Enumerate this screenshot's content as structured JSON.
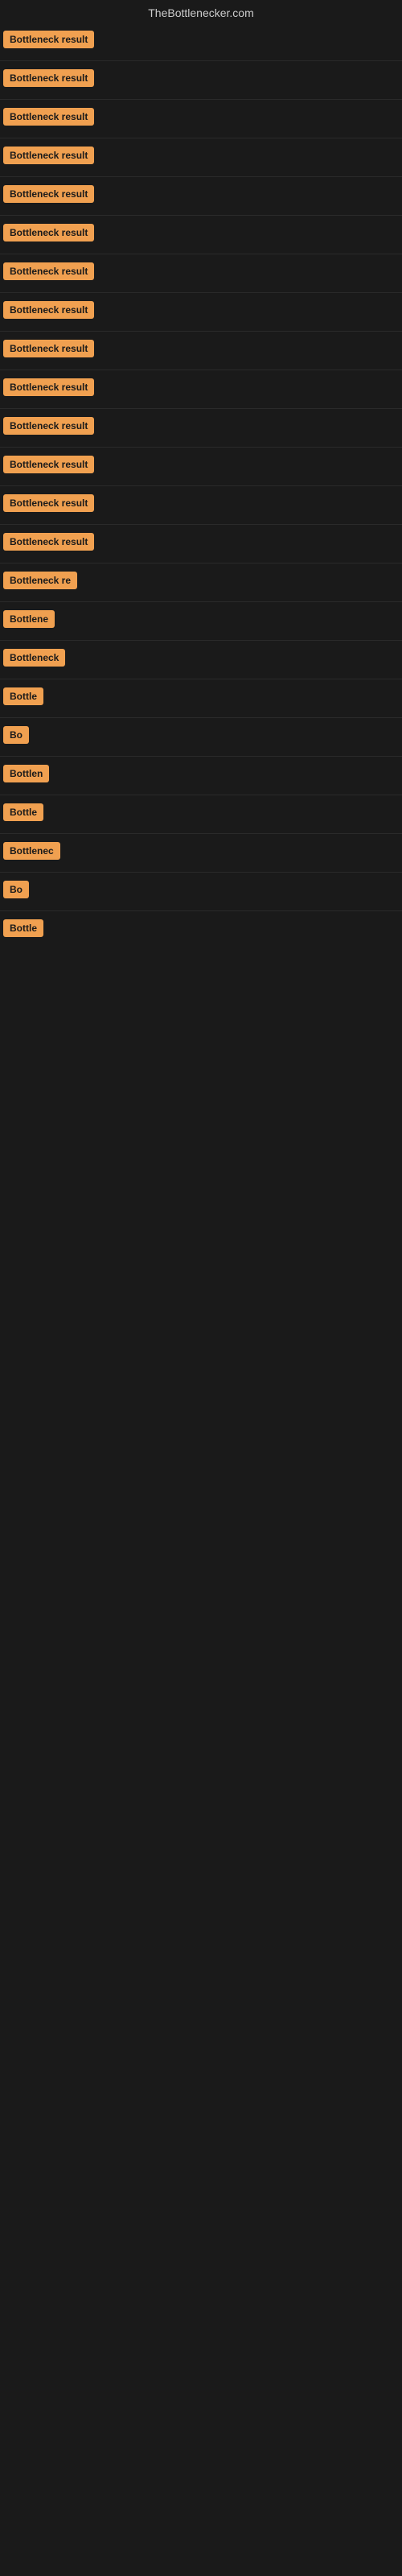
{
  "header": {
    "title": "TheBottlenecker.com"
  },
  "colors": {
    "badge_bg": "#f0a050",
    "page_bg": "#1a1a1a",
    "text_color": "#cccccc"
  },
  "results": [
    {
      "id": 1,
      "label": "Bottleneck result",
      "width": 135
    },
    {
      "id": 2,
      "label": "Bottleneck result",
      "width": 135
    },
    {
      "id": 3,
      "label": "Bottleneck result",
      "width": 135
    },
    {
      "id": 4,
      "label": "Bottleneck result",
      "width": 135
    },
    {
      "id": 5,
      "label": "Bottleneck result",
      "width": 135
    },
    {
      "id": 6,
      "label": "Bottleneck result",
      "width": 135
    },
    {
      "id": 7,
      "label": "Bottleneck result",
      "width": 135
    },
    {
      "id": 8,
      "label": "Bottleneck result",
      "width": 135
    },
    {
      "id": 9,
      "label": "Bottleneck result",
      "width": 135
    },
    {
      "id": 10,
      "label": "Bottleneck result",
      "width": 135
    },
    {
      "id": 11,
      "label": "Bottleneck result",
      "width": 135
    },
    {
      "id": 12,
      "label": "Bottleneck result",
      "width": 135
    },
    {
      "id": 13,
      "label": "Bottleneck result",
      "width": 135
    },
    {
      "id": 14,
      "label": "Bottleneck result",
      "width": 135
    },
    {
      "id": 15,
      "label": "Bottleneck re",
      "width": 105
    },
    {
      "id": 16,
      "label": "Bottlene",
      "width": 80
    },
    {
      "id": 17,
      "label": "Bottleneck",
      "width": 90
    },
    {
      "id": 18,
      "label": "Bottle",
      "width": 68
    },
    {
      "id": 19,
      "label": "Bo",
      "width": 35
    },
    {
      "id": 20,
      "label": "Bottlen",
      "width": 75
    },
    {
      "id": 21,
      "label": "Bottle",
      "width": 65
    },
    {
      "id": 22,
      "label": "Bottlenec",
      "width": 85
    },
    {
      "id": 23,
      "label": "Bo",
      "width": 33
    },
    {
      "id": 24,
      "label": "Bottle",
      "width": 62
    }
  ]
}
